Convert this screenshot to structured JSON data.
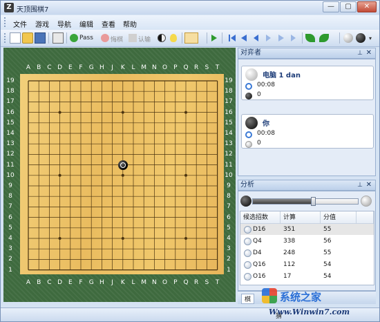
{
  "window": {
    "title": "天顶围棋7",
    "buttons": {
      "minimize": "—",
      "restore": "▢",
      "close": "✕"
    }
  },
  "menu": [
    "文件",
    "游戏",
    "导航",
    "编辑",
    "查看",
    "帮助"
  ],
  "toolbar": {
    "pass_label": "Pass",
    "undo_label": "悔棋",
    "resign_label": "认输",
    "colors": {
      "pass": "#2f9a2f",
      "disabled": "#9a9a9a"
    }
  },
  "board": {
    "columns": [
      "A",
      "B",
      "C",
      "D",
      "E",
      "F",
      "G",
      "H",
      "J",
      "K",
      "L",
      "M",
      "N",
      "O",
      "P",
      "Q",
      "R",
      "S",
      "T"
    ],
    "rows": [
      "19",
      "18",
      "17",
      "16",
      "15",
      "14",
      "13",
      "12",
      "11",
      "10",
      "9",
      "8",
      "7",
      "6",
      "5",
      "4",
      "3",
      "2",
      "1"
    ],
    "stones": [
      {
        "point": "K11",
        "color": "black",
        "last_move": true
      }
    ],
    "colors": {
      "surround": "#3e6a3e",
      "wood": "#eec266",
      "line": "#4b3410"
    }
  },
  "players_panel": {
    "title": "对弈者",
    "players": [
      {
        "name": "电脑 1 dan",
        "stone": "white",
        "time": "00:08",
        "captures": "0"
      },
      {
        "name": "你",
        "stone": "black",
        "time": "00:08",
        "captures": "0"
      }
    ]
  },
  "analysis_panel": {
    "title": "分析",
    "slider_value": 0.57,
    "table": {
      "headers": [
        "候选招数",
        "计算",
        "分值"
      ],
      "rows": [
        [
          "D16",
          "351",
          "55"
        ],
        [
          "Q4",
          "338",
          "56"
        ],
        [
          "D4",
          "248",
          "55"
        ],
        [
          "Q16",
          "112",
          "54"
        ],
        [
          "O16",
          "17",
          "54"
        ]
      ]
    }
  },
  "bottom_tabs": [
    "棋"
  ],
  "status": {
    "left": "猜"
  },
  "watermark": {
    "top": "系统之家",
    "bottom": "Www.Winwin7.com"
  }
}
